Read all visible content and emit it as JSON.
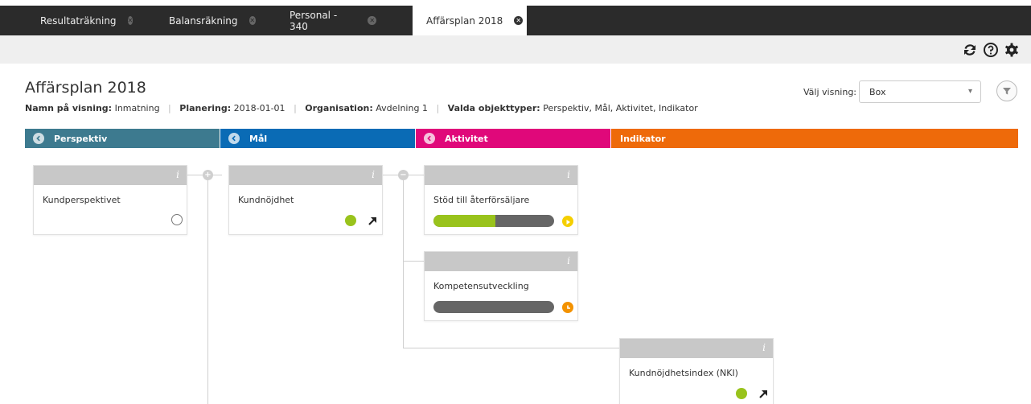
{
  "tabs": [
    {
      "label": "Resultaträkning"
    },
    {
      "label": "Balansräkning"
    },
    {
      "label": "Personal - 340"
    },
    {
      "label": "Affärsplan 2018"
    }
  ],
  "page": {
    "title": "Affärsplan 2018",
    "meta": [
      {
        "key": "Namn på visning:",
        "value": "Inmatning"
      },
      {
        "key": "Planering:",
        "value": "2018-01-01"
      },
      {
        "key": "Organisation:",
        "value": "Avdelning 1"
      },
      {
        "key": "Valda objekttyper:",
        "value": "Perspektiv, Mål, Aktivitet, Indikator"
      }
    ]
  },
  "view": {
    "label": "Välj visning:",
    "selected": "Box"
  },
  "columns": [
    {
      "label": "Perspektiv",
      "color": "#3d7a8f"
    },
    {
      "label": "Mål",
      "color": "#0a6bb5"
    },
    {
      "label": "Aktivitet",
      "color": "#e0087a"
    },
    {
      "label": "Indikator",
      "color": "#ee6a0a"
    }
  ],
  "cards": {
    "kundperspektivet": {
      "title": "Kundperspektivet",
      "status": "empty"
    },
    "kundnojdhet": {
      "title": "Kundnöjdhet",
      "status": "green",
      "trend": "up-right"
    },
    "stod": {
      "title": "Stöd till återförsäljare",
      "progress": 0.51,
      "status": "yellow",
      "status_icon": "play-icon"
    },
    "kompetens": {
      "title": "Kompetensutveckling",
      "progress": 0,
      "status": "orange",
      "status_icon": "clock-icon"
    },
    "nki": {
      "title": "Kundnöjdhetsindex (NKI)",
      "status": "green",
      "trend": "up-right"
    }
  },
  "info_label": "i",
  "nodes": {
    "expand": "+",
    "collapse": "−"
  },
  "colors": {
    "green": "#99c31c",
    "yellow": "#f5cf00",
    "orange": "#f39200",
    "card_header": "#c8c8c8",
    "tab_bar": "#2b2b2b"
  }
}
